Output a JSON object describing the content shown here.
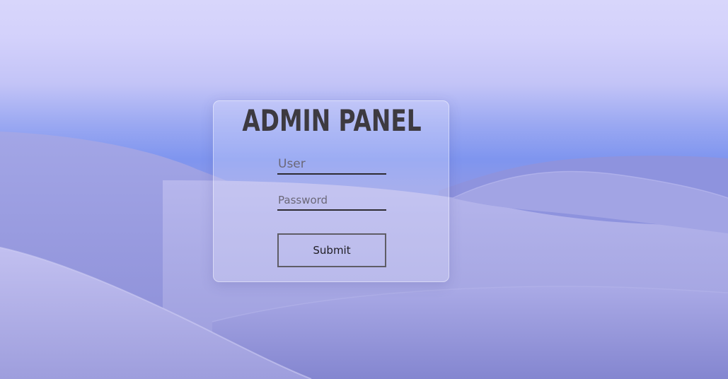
{
  "page": {
    "title": "ADMIN PANEL"
  },
  "form": {
    "user_placeholder": "User",
    "password_placeholder": "Password",
    "submit_label": "Submit"
  },
  "colors": {
    "sky_top": "#d8d6fb",
    "sky_horizon": "#7f95ef",
    "dune": "#8b8fd9",
    "title_text": "#3d3a40",
    "field_underline": "#2e2c33",
    "button_border": "#5f5d66"
  }
}
